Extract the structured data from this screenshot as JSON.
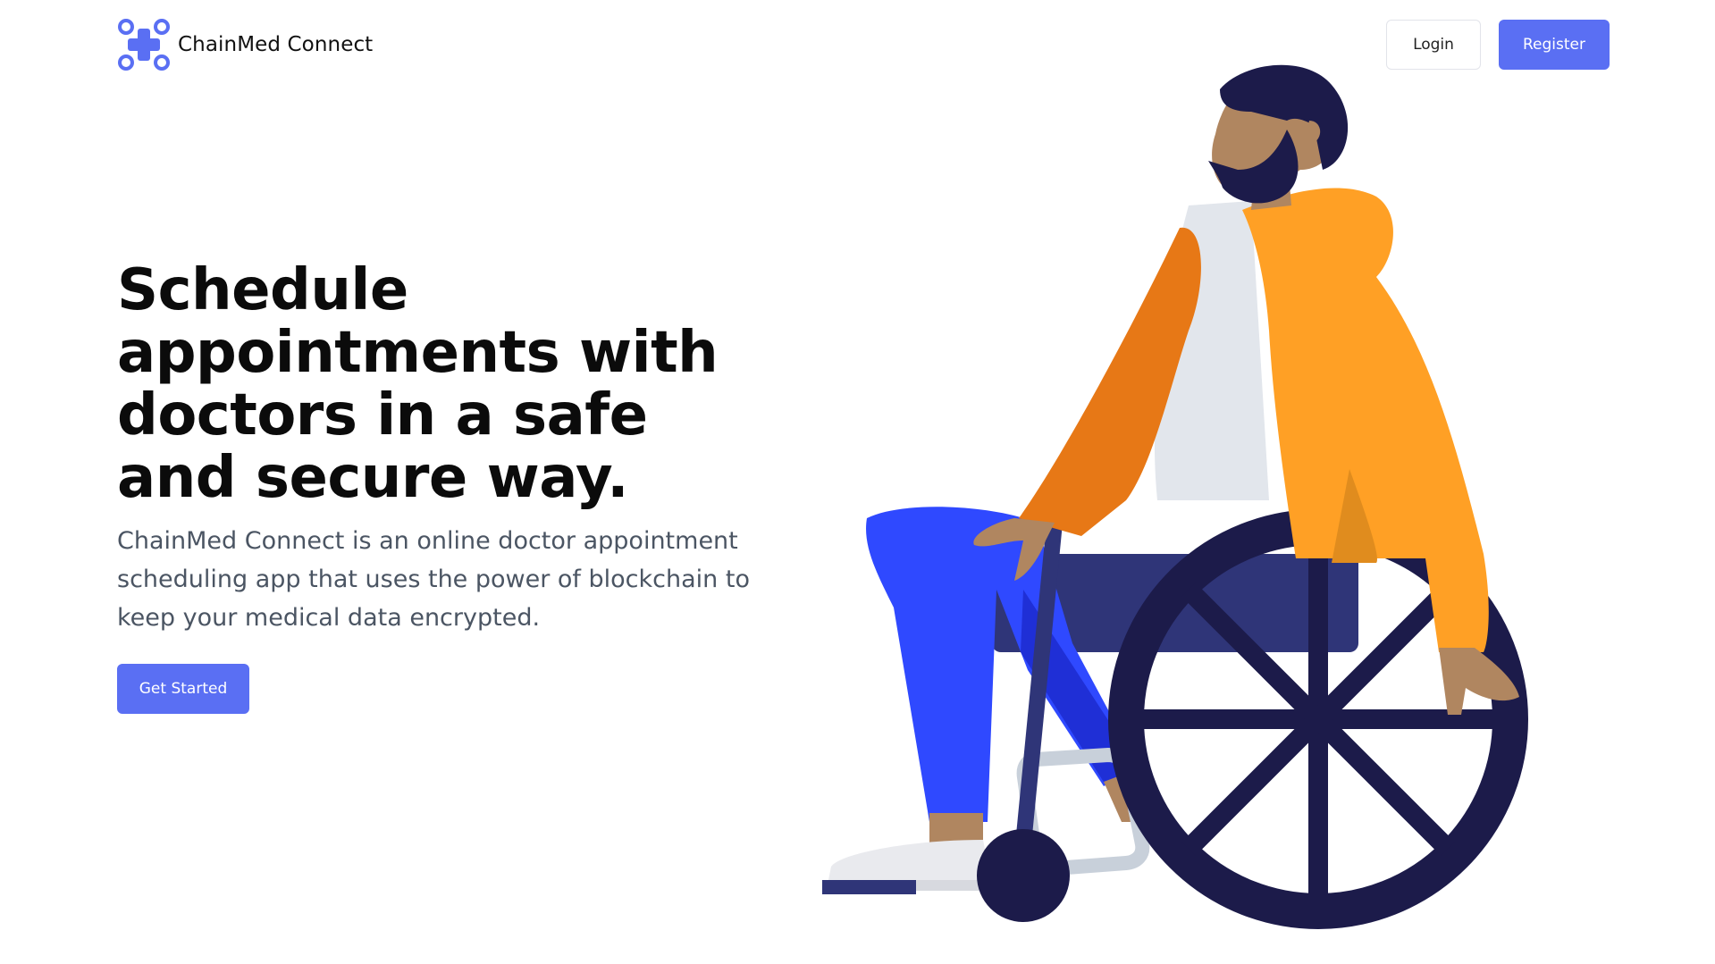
{
  "brand": {
    "name": "ChainMed Connect",
    "logo_icon": "medical-cross-network-icon",
    "accent_color": "#5a6ff3"
  },
  "nav": {
    "login_label": "Login",
    "register_label": "Register"
  },
  "hero": {
    "title": "Schedule appointments with doctors in a safe and secure way.",
    "subtitle": "ChainMed Connect is an online doctor appointment scheduling app that uses the power of blockchain to keep your medical data encrypted.",
    "cta_label": "Get Started",
    "illustration": "person-in-wheelchair-illustration"
  }
}
